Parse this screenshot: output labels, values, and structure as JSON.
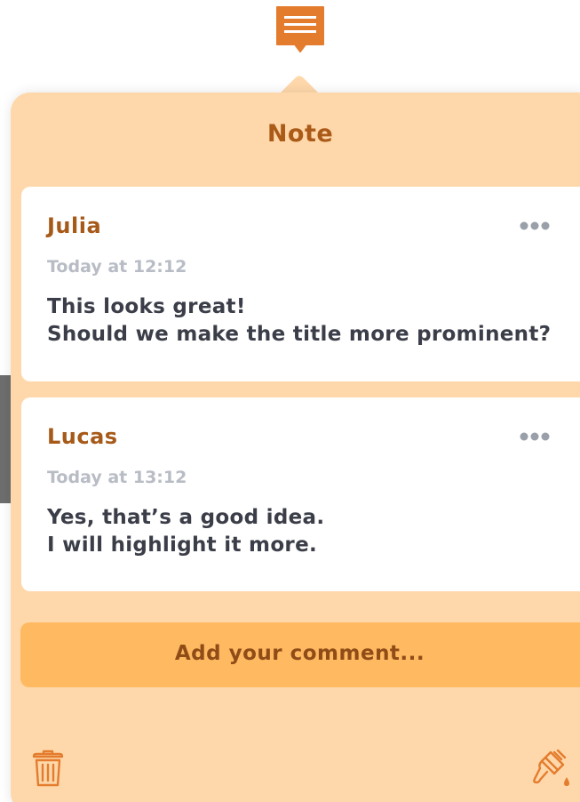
{
  "popover": {
    "title": "Note"
  },
  "comments": [
    {
      "author": "Julia",
      "timestamp": "Today at 12:12",
      "lines": [
        "This looks great!",
        "Should we make the title more prominent?"
      ]
    },
    {
      "author": "Lucas",
      "timestamp": "Today at 13:12",
      "lines": [
        "Yes, that’s a good idea.",
        "I will highlight it more."
      ]
    }
  ],
  "comment_input": {
    "placeholder": "Add your comment..."
  },
  "icons": {
    "note_marker": "note-marker-icon",
    "more": "more-options-icon",
    "trash": "trash-icon",
    "paint": "paint-brush-icon"
  },
  "colors": {
    "accent": "#e47c2e",
    "popover_bg": "#fed8aa",
    "input_bg": "#ffb961",
    "author": "#a65a19",
    "title": "#ab5a18",
    "timestamp": "#b8bcc4",
    "body_text": "#3b3e48"
  }
}
